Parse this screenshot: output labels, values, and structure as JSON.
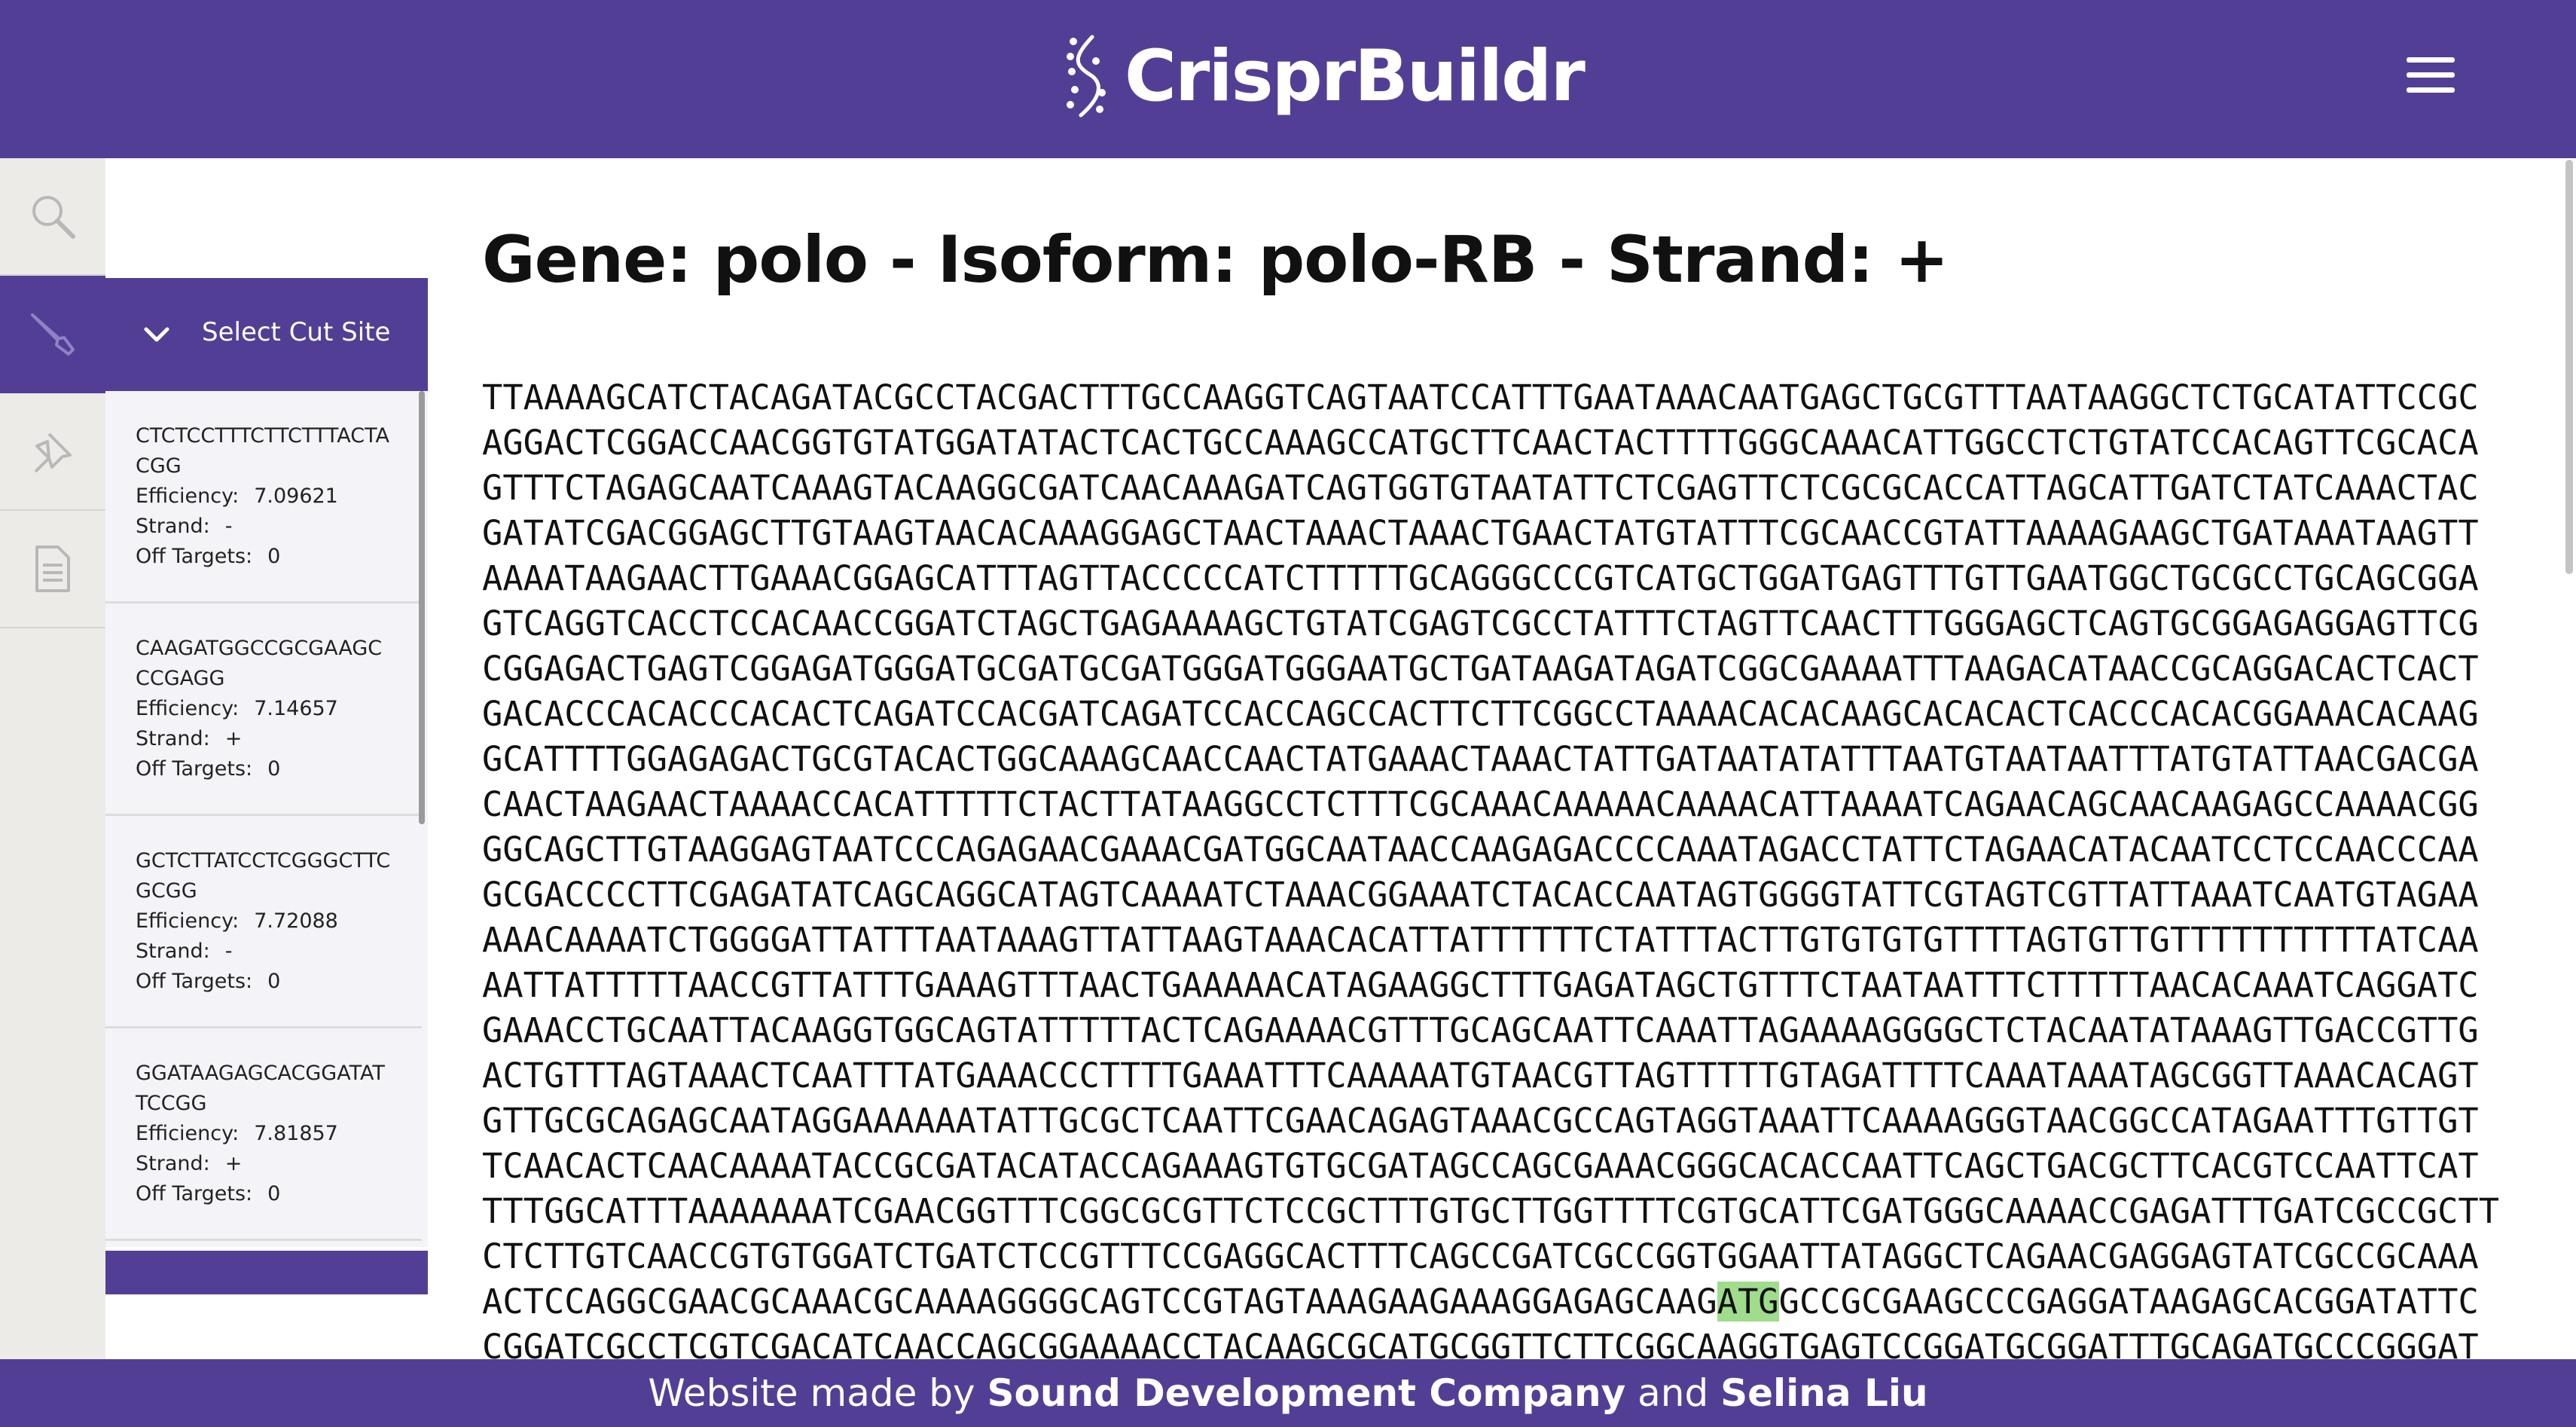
{
  "app": {
    "name": "CrisprBuildr",
    "brand_color": "#523f95",
    "logo_icon": "dna-helix-icon",
    "menu_icon": "hamburger-menu-icon"
  },
  "rail": {
    "items": [
      {
        "icon": "search-icon"
      },
      {
        "icon": "scalpel-icon"
      },
      {
        "icon": "pin-icon"
      },
      {
        "icon": "document-icon"
      }
    ]
  },
  "cut_panel": {
    "title": "Select Cut Site",
    "toggle_icon": "chevron-down-icon",
    "efficiency_label": "Efficiency:",
    "strand_label": "Strand:",
    "off_targets_label": "Off Targets:",
    "sites": [
      {
        "sequence": "CTCTCCTTTCTTCTTTACTACGG",
        "efficiency": "7.09621",
        "strand": "-",
        "off_targets": "0"
      },
      {
        "sequence": "CAAGATGGCCGCGAAGCCCGAGG",
        "efficiency": "7.14657",
        "strand": "+",
        "off_targets": "0"
      },
      {
        "sequence": "GCTCTTATCCTCGGGCTTCGCGG",
        "efficiency": "7.72088",
        "strand": "-",
        "off_targets": "0"
      },
      {
        "sequence": "GGATAAGAGCACGGATATTCCGG",
        "efficiency": "7.81857",
        "strand": "+",
        "off_targets": "0"
      }
    ]
  },
  "main": {
    "title": "Gene: polo - Isoform: polo-RB - Strand: +",
    "highlight_color": "#9fdc8c",
    "sequence_lines": [
      {
        "text": "TTAAAAGCATCTACAGATACGCCTACGACTTTGCCAAGGTCAGTAATCCATTTGAATAAACAATGAGCTGCGTTTAATAAGGCTCTGCATATTCCGC"
      },
      {
        "text": "AGGACTCGGACCAACGGTGTATGGATATACTCACTGCCAAAGCCATGCTTCAACTACTTTTGGGCAAACATTGGCCTCTGTATCCACAGTTCGCACA"
      },
      {
        "text": "GTTTCTAGAGCAATCAAAGTACAAGGCGATCAACAAAGATCAGTGGTGTAATATTCTCGAGTTCTCGCGCACCATTAGCATTGATCTATCAAACTAC"
      },
      {
        "text": "GATATCGACGGAGCTTGTAAGTAACACAAAGGAGCTAACTAAACTAAACTGAACTATGTATTTCGCAACCGTATTAAAAGAAGCTGATAAATAAGTT"
      },
      {
        "text": "AAAATAAGAACTTGAAACGGAGCATTTAGTTACCCCCATCTTTTTGCAGGGCCCGTCATGCTGGATGAGTTTGTTGAATGGCTGCGCCTGCAGCGGA"
      },
      {
        "text": "GTCAGGTCACCTCCACAACCGGATCTAGCTGAGAAAAGCTGTATCGAGTCGCCTATTTCTAGTTCAACTTTGGGAGCTCAGTGCGGAGAGGAGTTCG"
      },
      {
        "text": "CGGAGACTGAGTCGGAGATGGGATGCGATGCGATGGGATGGGAATGCTGATAAGATAGATCGGCGAAAATTTAAGACATAACCGCAGGACACTCACT"
      },
      {
        "text": "GACACCCACACCCACACTCAGATCCACGATCAGATCCACCAGCCACTTCTTCGGCCTAAAACACACAAGCACACACTCACCCACACGGAAACACAAG"
      },
      {
        "text": "GCATTTTGGAGAGACTGCGTACACTGGCAAAGCAACCAACTATGAAACTAAACTATTGATAATATATTTAATGTAATAATTTATGTATTAACGACGA"
      },
      {
        "text": "CAACTAAGAACTAAAACCACATTTTTCTACTTATAAGGCCTCTTTCGCAAACAAAAACAAAACATTAAAATCAGAACAGCAACAAGAGCCAAAACGG"
      },
      {
        "text": "GGCAGCTTGTAAGGAGTAATCCCAGAGAACGAAACGATGGCAATAACCAAGAGACCCCAAATAGACCTATTCTAGAACATACAATCCTCCAACCCAA"
      },
      {
        "text": "GCGACCCCTTCGAGATATCAGCAGGCATAGTCAAAATCTAAACGGAAATCTACACCAATAGTGGGGTATTCGTAGTCGTTATTAAATCAATGTAGAA"
      },
      {
        "text": "AAACAAAATCTGGGGATTATTTAATAAAGTTATTAAGTAAACACATTATTTTTTCTATTTACTTGTGTGTGTTTTAGTGTTGTTTTTTTTTTATCAA"
      },
      {
        "text": "AATTATTTTTAACCGTTATTTGAAAGTTTAACTGAAAAACATAGAAGGCTTTGAGATAGCTGTTTCTAATAATTTCTTTTTAACACAAATCAGGATC"
      },
      {
        "text": "GAAACCTGCAATTACAAGGTGGCAGTATTTTTACTCAGAAAACGTTTGCAGCAATTCAAATTAGAAAAGGGGCTCTACAATATAAAGTTGACCGTTG"
      },
      {
        "text": "ACTGTTTAGTAAACTCAATTTATGAAACCCTTTTGAAATTTCAAAAATGTAACGTTAGTTTTTGTAGATTTTCAAATAAATAGCGGTTAAACACAGT"
      },
      {
        "text": "GTTGCGCAGAGCAATAGGAAAAAATATTGCGCTCAATTCGAACAGAGTAAACGCCAGTAGGTAAATTCAAAAGGGTAACGGCCATAGAATTTGTTGT"
      },
      {
        "text": "TCAACACTCAACAAAATACCGCGATACATACCAGAAAGTGTGCGATAGCCAGCGAAACGGGCACACCAATTCAGCTGACGCTTCACGTCCAATTCAT"
      },
      {
        "text": "TTTGGCATTTAAAAAAATCGAACGGTTTCGGCGCGTTCTCCGCTTTGTGCTTGGTTTTCGTGCATTCGATGGGCAAAACCGAGATTTGATCGCCGCTT"
      },
      {
        "text": "CTCTTGTCAACCGTGTGGATCTGATCTCCGTTTCCGAGGCACTTTCAGCCGATCGCCGGTGGAATTATAGGCTCAGAACGAGGAGTATCGCCGCAAA"
      },
      {
        "pre": "ACTCCAGGCGAACGCAAACGCAAAAGGGGCAGTCCGTAGTAAAGAAGAAAGGAGAGCAAG",
        "highlight": "ATG",
        "post": "GCCGCGAAGCCCGAGGATAAGAGCACGGATATTC"
      },
      {
        "text": "CGGATCGCCTCGTCGACATCAACCAGCGGAAAACCTACAAGCGCATGCGGTTCTTCGGCAAGGTGAGTCCGGATGCGGATTTGCAGATGCCCGGGAT"
      }
    ]
  },
  "footer": {
    "prefix": "Website made by ",
    "company": "Sound Development Company",
    "conj": " and ",
    "person": "Selina Liu"
  }
}
